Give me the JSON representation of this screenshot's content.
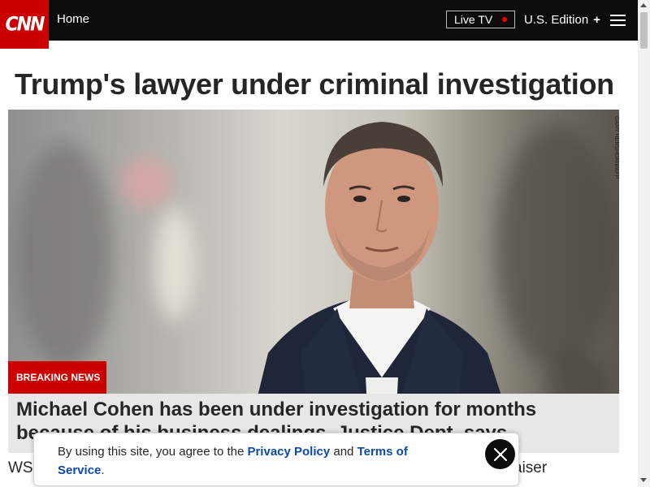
{
  "header": {
    "logo_text": "CNN",
    "home_label": "Home",
    "live_tv_label": "Live TV",
    "edition_label": "U.S. Edition",
    "edition_icon": "plus-icon",
    "menu_icon": "hamburger-menu-icon"
  },
  "article": {
    "headline": "Trump's lawyer under criminal investigation",
    "image_credit": "GARY HERSHORN/AFP",
    "badge": "BREAKING NEWS",
    "caption": "Michael Cohen has been under investigation for months because of his business dealings, Justice Dept. says"
  },
  "below": {
    "left_fragment": "WS",
    "right_fragment": "aiser"
  },
  "cookie_banner": {
    "text_before": "By using this site, you agree to the ",
    "privacy_link": "Privacy Policy",
    "text_and": " and ",
    "terms_link": "Terms of Service",
    "text_end": ".",
    "close_icon": "close-icon"
  },
  "colors": {
    "brand_red": "#cc0000",
    "header_bg": "#0c0c0c",
    "link_blue": "#0c4aa8"
  }
}
